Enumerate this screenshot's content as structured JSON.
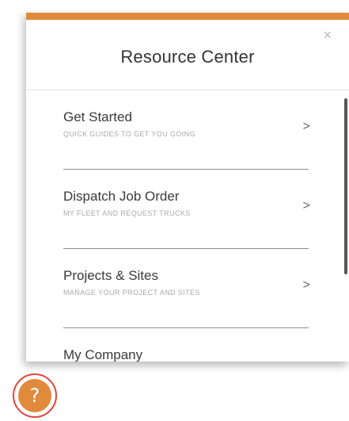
{
  "resource_center": {
    "title": "Resource Center",
    "close_glyph": "×",
    "items": [
      {
        "title": "Get Started",
        "subtitle": "QUICK GUIDES TO GET YOU GOING",
        "chevron": ">"
      },
      {
        "title": "Dispatch Job Order",
        "subtitle": "MY FLEET AND REQUEST TRUCKS",
        "chevron": ">"
      },
      {
        "title": "Projects & Sites",
        "subtitle": "MANAGE YOUR PROJECT AND SITES",
        "chevron": ">"
      },
      {
        "title": "My Company",
        "subtitle": "",
        "chevron": ""
      }
    ]
  },
  "help_button": {
    "glyph": "?"
  },
  "colors": {
    "accent": "#e08a3c",
    "highlight_ring": "#e0453c"
  },
  "icons": {
    "close": "close-icon",
    "chevron": "chevron-right-icon",
    "help": "question-mark-icon"
  }
}
